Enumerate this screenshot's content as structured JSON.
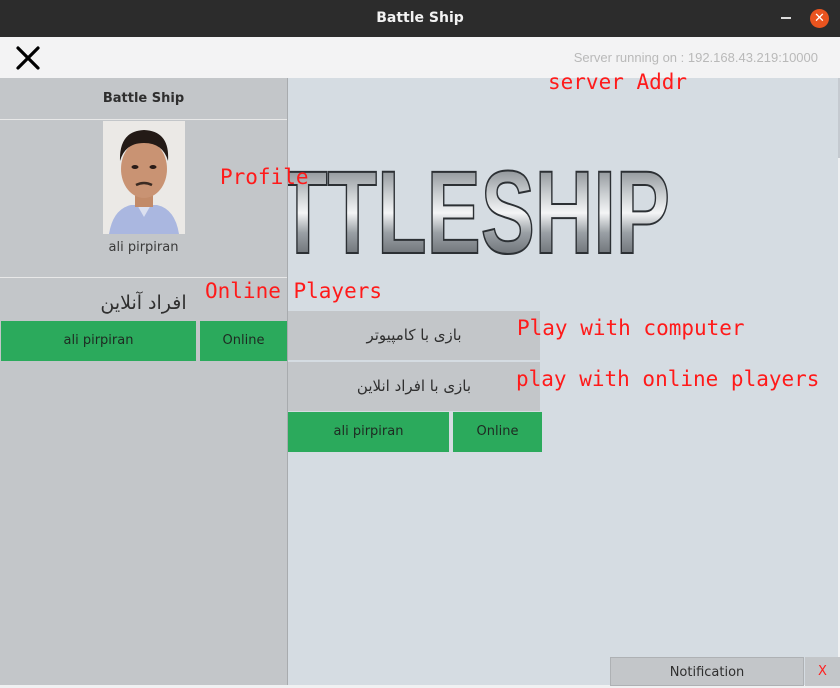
{
  "window": {
    "title": "Battle Ship"
  },
  "toolbar": {
    "server_text": "Server running on : 192.168.43.219:10000"
  },
  "sidebar": {
    "title": "Battle Ship",
    "profile_name": "ali pirpiran",
    "online_title": "افراد آنلاین",
    "players": [
      {
        "name": "ali pirpiran",
        "status": "Online"
      }
    ]
  },
  "main": {
    "logo_text": "TTLESHIP",
    "buttons": {
      "play_computer": "بازی با کامپیوتر",
      "play_online": "بازی با افراد انلاین"
    },
    "players": [
      {
        "name": "ali pirpiran",
        "status": "Online"
      }
    ]
  },
  "annotations": {
    "server": "server Addr",
    "profile": "Profile",
    "online": "Online Players",
    "computer": "Play with computer",
    "online_play": "play with online players"
  },
  "notification": {
    "label": "Notification",
    "close": "X"
  },
  "colors": {
    "online_green": "#2baa5c",
    "accent_close": "#e9541f",
    "annotation_red": "#ff1a1a"
  }
}
